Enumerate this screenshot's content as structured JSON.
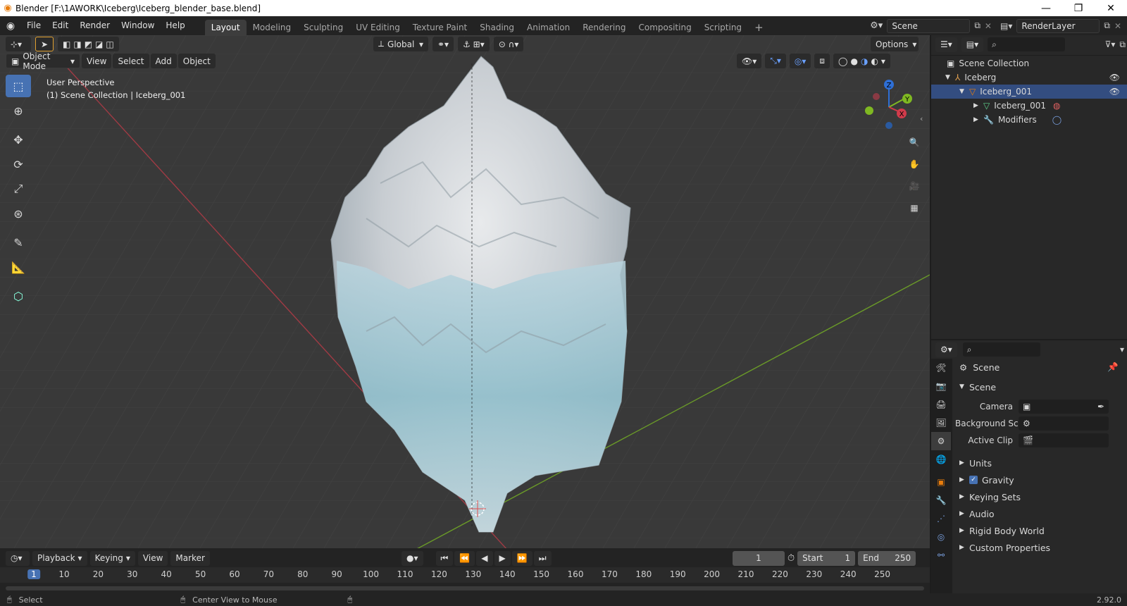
{
  "window": {
    "title": "Blender [F:\\1AWORK\\Iceberg\\Iceberg_blender_base.blend]",
    "controls": [
      "—",
      "❐",
      "✕"
    ]
  },
  "topbar": {
    "menus": [
      "File",
      "Edit",
      "Render",
      "Window",
      "Help"
    ],
    "workspaces": [
      "Layout",
      "Modeling",
      "Sculpting",
      "UV Editing",
      "Texture Paint",
      "Shading",
      "Animation",
      "Rendering",
      "Compositing",
      "Scripting"
    ],
    "active_workspace": "Layout",
    "add_workspace": "+",
    "scene": "Scene",
    "view_layer": "RenderLayer"
  },
  "viewport": {
    "orientation": "Global",
    "options_label": "Options",
    "mode": "Object Mode",
    "menus": [
      "View",
      "Select",
      "Add",
      "Object"
    ],
    "perspective_label": "User Perspective",
    "collection_label": "(1) Scene Collection | Iceberg_001",
    "gizmo_axes": {
      "z": "Z",
      "y": "Y",
      "x": "X"
    }
  },
  "timeline": {
    "menus": [
      "Playback",
      "Keying",
      "View",
      "Marker"
    ],
    "current_frame": "1",
    "start_label": "Start",
    "start_value": "1",
    "end_label": "End",
    "end_value": "250",
    "ruler": [
      "1",
      "10",
      "20",
      "30",
      "40",
      "50",
      "60",
      "70",
      "80",
      "90",
      "100",
      "110",
      "120",
      "130",
      "140",
      "150",
      "160",
      "170",
      "180",
      "190",
      "200",
      "210",
      "220",
      "230",
      "240",
      "250"
    ]
  },
  "outliner": {
    "root": "Scene Collection",
    "items": [
      {
        "label": "Iceberg",
        "depth": 1,
        "expanded": true,
        "icon": "collection-icon",
        "eye": true
      },
      {
        "label": "Iceberg_001",
        "depth": 2,
        "expanded": true,
        "icon": "object-icon",
        "eye": true
      },
      {
        "label": "Iceberg_001",
        "depth": 3,
        "expanded": false,
        "icon": "mesh-data-icon"
      },
      {
        "label": "Modifiers",
        "depth": 3,
        "expanded": false,
        "icon": "wrench-icon"
      }
    ]
  },
  "properties": {
    "context_label": "Scene",
    "panel_title": "Scene",
    "fields": [
      {
        "label": "Camera",
        "value": ""
      },
      {
        "label": "Background Sce...",
        "value": ""
      },
      {
        "label": "Active Clip",
        "value": ""
      }
    ],
    "sections": [
      {
        "label": "Units",
        "checkbox": false
      },
      {
        "label": "Gravity",
        "checkbox": true
      },
      {
        "label": "Keying Sets",
        "checkbox": false
      },
      {
        "label": "Audio",
        "checkbox": false
      },
      {
        "label": "Rigid Body World",
        "checkbox": false
      },
      {
        "label": "Custom Properties",
        "checkbox": false
      }
    ]
  },
  "statusbar": {
    "select_label": "Select",
    "center_view_label": "Center View to Mouse",
    "version": "2.92.0"
  },
  "colors": {
    "accent": "#4772b3",
    "x_axis": "#d13b4b",
    "y_axis": "#7fb822",
    "z_axis": "#2e6fd6",
    "orange": "#e87d0d"
  }
}
